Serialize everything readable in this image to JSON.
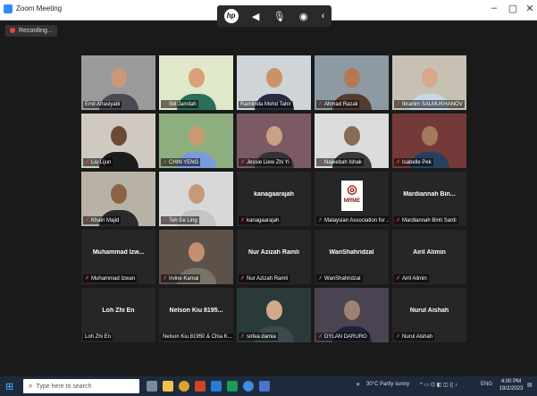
{
  "window": {
    "title": "Zoom Meeting",
    "minimize": "–",
    "maximize": "▢",
    "close": "✕"
  },
  "zoom_controls": {
    "brand": "hp",
    "icons": [
      "sound-icon",
      "microphone-icon",
      "camera-icon",
      "back-icon"
    ]
  },
  "recording": {
    "label": "Recording..."
  },
  "participants": [
    {
      "label": "Emil Afrasiyabi",
      "video": true,
      "muted": false
    },
    {
      "label": "Siti Jamilah",
      "video": true,
      "muted": true,
      "active": true
    },
    {
      "label": "Ramlinda Mohd Tahir",
      "video": true,
      "muted": false
    },
    {
      "label": "Ahmad Razali",
      "video": true,
      "muted": true
    },
    {
      "label": "Ibrahim SALMUKHANOV",
      "video": true,
      "muted": true
    },
    {
      "label": "Liu Lijun",
      "video": true,
      "muted": true
    },
    {
      "label": "CHIN YENG",
      "video": true,
      "muted": true
    },
    {
      "label": "Jessie Liew Zhi Yi",
      "video": true,
      "muted": true
    },
    {
      "label": "Najeebah Ishak",
      "video": true,
      "muted": true
    },
    {
      "label": "Isabelle Pek",
      "video": true,
      "muted": true
    },
    {
      "label": "Khairi Majid",
      "video": true,
      "muted": true
    },
    {
      "label": "Teh Ee Ling",
      "video": true,
      "muted": true
    },
    {
      "name": "kanagaarajah",
      "label": "kanagaarajah",
      "video": false,
      "muted": true
    },
    {
      "label": "Malaysian Association for ...",
      "logo": "MRME",
      "video": false,
      "muted": true
    },
    {
      "name": "Mardiannah Bin...",
      "label": "Mardiannah Binti Sardi",
      "video": false,
      "muted": true
    },
    {
      "name": "Muhammad Izw...",
      "label": "Muhammad Izwan",
      "video": false,
      "muted": true
    },
    {
      "label": "Irvine Kamal",
      "video": true,
      "muted": true
    },
    {
      "name": "Nur Azizah Ramli",
      "label": "Nur Azizah Ramli",
      "video": false,
      "muted": true
    },
    {
      "name": "WanShahridzal",
      "label": "WanShahridzal",
      "video": false,
      "muted": true
    },
    {
      "name": "Airil Alimin",
      "label": "Airil Alimin",
      "video": false,
      "muted": true
    },
    {
      "name": "Loh Zhi En",
      "label": "Loh Zhi En",
      "video": false,
      "muted": false
    },
    {
      "name": "Nelson Kiu 8195...",
      "label": "Nelson Kiu 81950 & Chia K...",
      "video": false,
      "muted": false
    },
    {
      "label": "sofea damia",
      "video": true,
      "muted": true
    },
    {
      "label": "DYLAN DARURO",
      "video": true,
      "muted": true
    },
    {
      "name": "Nurul Aishah",
      "label": "Nurul Aishah",
      "video": false,
      "muted": true
    }
  ],
  "taskbar": {
    "search_placeholder": "Type here to search",
    "weather": "30°C  Partly sunny",
    "language": "ENG",
    "time": "4:00 PM",
    "date": "19/2/2023"
  },
  "colors": {
    "active_speaker": "#b7e24a",
    "muted_icon": "#e64545",
    "taskbar": "#1d2a3c"
  }
}
